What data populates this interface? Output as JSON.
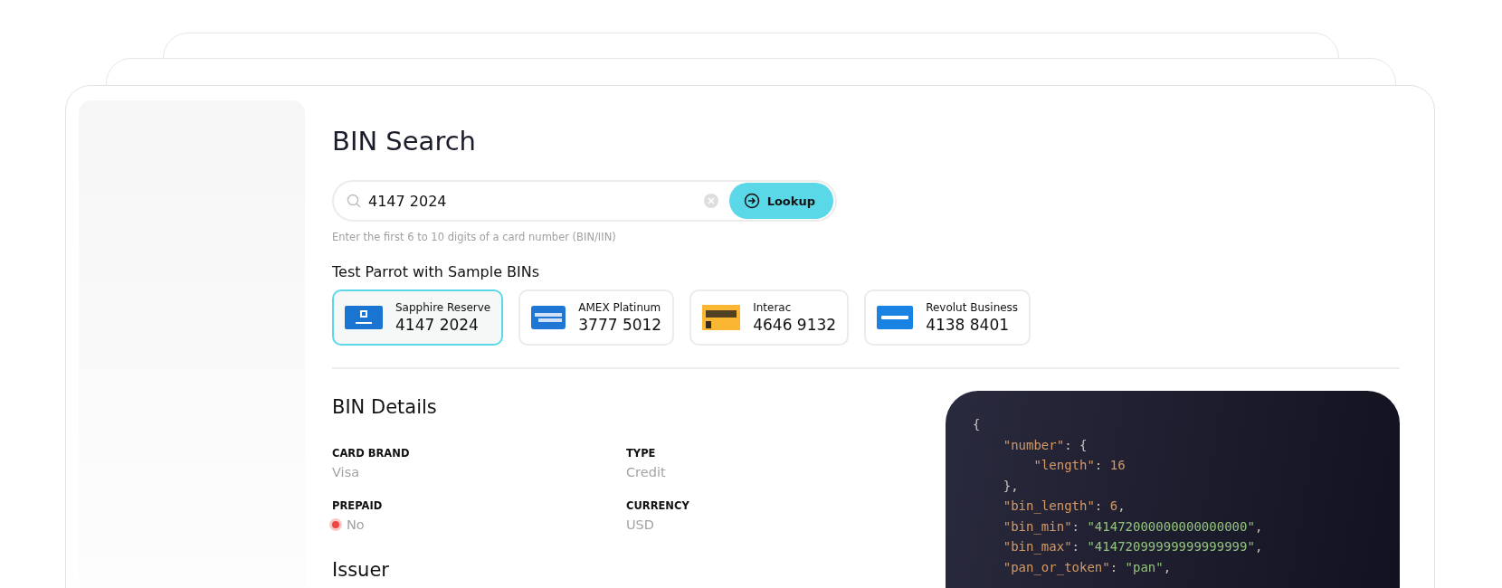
{
  "title": "BIN Search",
  "search": {
    "value": "4147 2024",
    "button": "Lookup",
    "hint": "Enter the first 6 to 10 digits of a card number (BIN/IIN)"
  },
  "samples_title": "Test Parrot with Sample BINs",
  "samples": [
    {
      "name": "Sapphire Reserve",
      "bin": "4147 2024",
      "kind": "chase",
      "selected": true
    },
    {
      "name": "AMEX Platinum",
      "bin": "3777 5012",
      "kind": "amex",
      "selected": false
    },
    {
      "name": "Interac",
      "bin": "4646 9132",
      "kind": "interac",
      "selected": false
    },
    {
      "name": "Revolut Business",
      "bin": "4138 8401",
      "kind": "revolut",
      "selected": false
    }
  ],
  "details_title": "BIN Details",
  "details": [
    {
      "label": "CARD BRAND",
      "value": "Visa"
    },
    {
      "label": "TYPE",
      "value": "Credit"
    },
    {
      "label": "PREPAID",
      "value": "No",
      "color": "#ef4444"
    },
    {
      "label": "CURRENCY",
      "value": "USD"
    }
  ],
  "issuer_title": "Issuer",
  "code": [
    [
      {
        "text": "{",
        "kind": "punct"
      }
    ],
    [
      {
        "text": "    \"number\"",
        "kind": "key"
      },
      {
        "text": ": {",
        "kind": "punct"
      }
    ],
    [
      {
        "text": "        \"length\"",
        "kind": "key"
      },
      {
        "text": ": ",
        "kind": "punct"
      },
      {
        "text": "16",
        "kind": "number"
      }
    ],
    [
      {
        "text": "    },",
        "kind": "punct"
      }
    ],
    [
      {
        "text": "    \"bin_length\"",
        "kind": "key"
      },
      {
        "text": ": ",
        "kind": "punct"
      },
      {
        "text": "6",
        "kind": "number"
      },
      {
        "text": ",",
        "kind": "punct"
      }
    ],
    [
      {
        "text": "    \"bin_min\"",
        "kind": "key"
      },
      {
        "text": ": ",
        "kind": "punct"
      },
      {
        "text": "\"41472000000000000000\"",
        "kind": "string"
      },
      {
        "text": ",",
        "kind": "punct"
      }
    ],
    [
      {
        "text": "    \"bin_max\"",
        "kind": "key"
      },
      {
        "text": ": ",
        "kind": "punct"
      },
      {
        "text": "\"41472099999999999999\"",
        "kind": "string"
      },
      {
        "text": ",",
        "kind": "punct"
      }
    ],
    [
      {
        "text": "    \"pan_or_token\"",
        "kind": "key"
      },
      {
        "text": ": ",
        "kind": "punct"
      },
      {
        "text": "\"pan\"",
        "kind": "string"
      },
      {
        "text": ",",
        "kind": "punct"
      }
    ]
  ]
}
